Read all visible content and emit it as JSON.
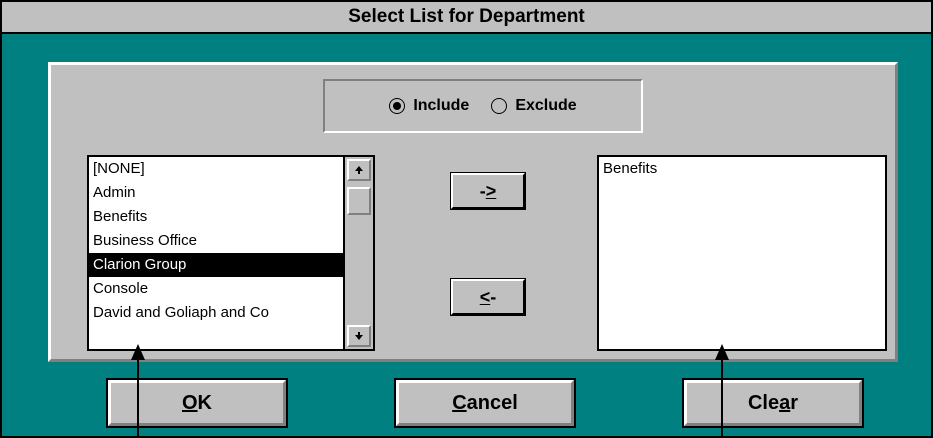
{
  "dialog": {
    "title": "Select List for Department"
  },
  "filter_mode": {
    "options": [
      {
        "label": "Include",
        "selected": true
      },
      {
        "label": "Exclude",
        "selected": false
      }
    ]
  },
  "available_list": {
    "items": [
      "[NONE]",
      "Admin",
      "Benefits",
      "Business Office",
      "Clarion Group",
      "Console",
      "David and Goliaph and Co"
    ],
    "selected_index": 4,
    "scroll_up_icon": "arrow-up-icon",
    "scroll_down_icon": "arrow-down-icon"
  },
  "move_buttons": {
    "add_label": "->",
    "add_accel": ">",
    "remove_label": "<-",
    "remove_accel": "<"
  },
  "selected_list": {
    "items": [
      "Benefits"
    ]
  },
  "buttons": {
    "ok": {
      "accel": "O",
      "rest": "K"
    },
    "cancel": {
      "accel": "C",
      "rest": "ancel"
    },
    "clear": {
      "pre": "Cle",
      "accel": "a",
      "rest": "r"
    }
  },
  "colors": {
    "background": "#008080",
    "panel": "#c0c0c0",
    "selection": "#000000"
  }
}
